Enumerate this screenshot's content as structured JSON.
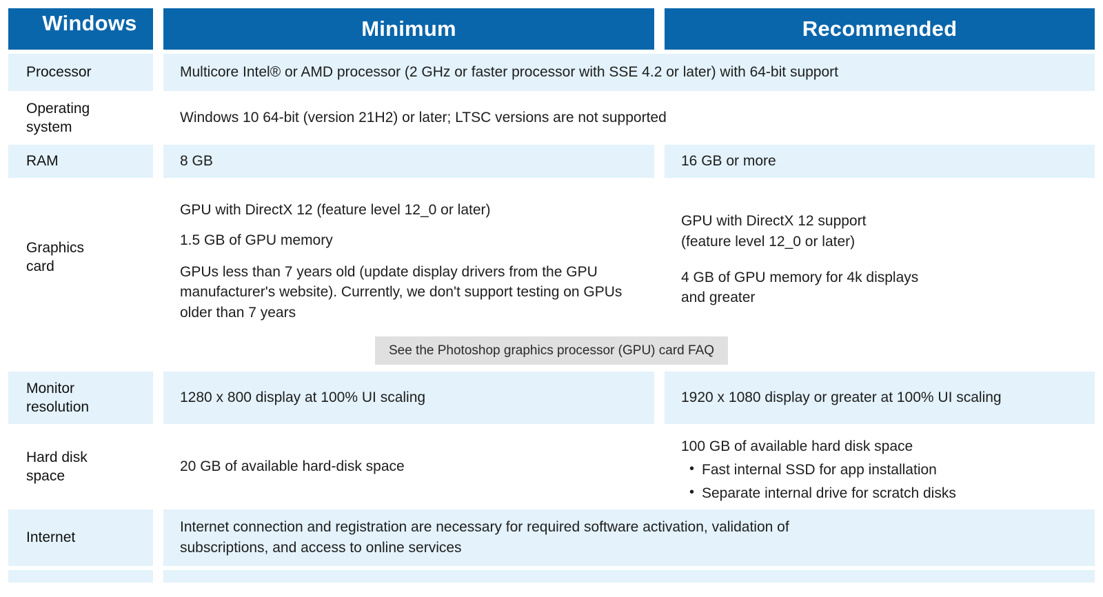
{
  "table": {
    "headers": {
      "platform": "Windows",
      "minimum": "Minimum",
      "recommended": "Recommended"
    },
    "colors": {
      "header_blue": "#0a66ab",
      "row_shade": "#e3f2fb",
      "note_grey": "#e0e0e0",
      "text": "#1d1d1d"
    },
    "rows": [
      {
        "label": "Processor",
        "span": true,
        "minimum": "Multicore Intel® or AMD processor (2 GHz or faster processor with SSE 4.2 or later) with 64-bit support"
      },
      {
        "label_line1": "Operating",
        "label_line2": "system",
        "span": true,
        "minimum": "Windows 10 64-bit (version 21H2) or later; LTSC versions are not supported"
      },
      {
        "label": "RAM",
        "minimum": "8 GB",
        "recommended": "16 GB or more"
      },
      {
        "label_line1": "Graphics",
        "label_line2": "card",
        "minimum_p1": "GPU with DirectX 12 (feature level 12_0 or later)",
        "minimum_p2": "1.5 GB of GPU memory",
        "minimum_p3": "GPUs less than 7 years old (update display drivers from the GPU manufacturer's website). Currently, we don't support testing on GPUs older than 7 years",
        "recommended_p1_line1": "GPU with DirectX 12 support",
        "recommended_p1_line2": "(feature level 12_0 or later)",
        "recommended_p2_line1": "4 GB of GPU memory for 4k displays",
        "recommended_p2_line2": "and greater"
      },
      {
        "label_line1": "Monitor",
        "label_line2": "resolution",
        "minimum": "1280 x 800 display at 100% UI scaling",
        "recommended": "1920 x 1080 display or greater at 100% UI scaling"
      },
      {
        "label_line1": "Hard disk",
        "label_line2": "space",
        "minimum": "20 GB of available hard-disk space",
        "recommended_heading": "100 GB of available hard disk space",
        "recommended_bullets": [
          "Fast internal SSD for app installation",
          "Separate internal drive for scratch disks"
        ]
      },
      {
        "label": "Internet",
        "span": true,
        "minimum_line1": "Internet connection and registration are necessary for required software activation, validation of",
        "minimum_line2": "subscriptions, and access to online services"
      }
    ],
    "note": "See the Photoshop graphics processor (GPU) card FAQ"
  }
}
